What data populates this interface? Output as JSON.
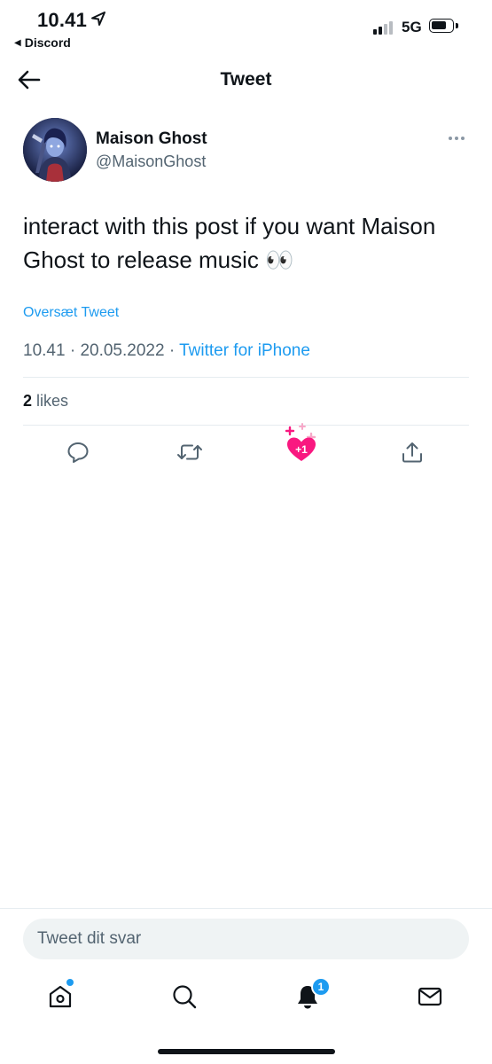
{
  "status_bar": {
    "time": "10.41",
    "back_app": "Discord",
    "network": "5G"
  },
  "header": {
    "title": "Tweet"
  },
  "tweet": {
    "author_name": "Maison Ghost",
    "author_handle": "@MaisonGhost",
    "text": "interact with this post if you want Maison Ghost to release music 👀",
    "translate_label": "Oversæt Tweet",
    "time": "10.41",
    "date": "20.05.2022",
    "client": "Twitter for iPhone",
    "likes_count": "2",
    "likes_label": "likes",
    "like_badge": "+1"
  },
  "reply": {
    "placeholder": "Tweet dit svar"
  },
  "tab_bar": {
    "notifications_badge": "1"
  },
  "colors": {
    "accent": "#1d9bf0",
    "like": "#f91880",
    "text": "#0f1419",
    "muted": "#536471"
  },
  "icons": [
    "location-arrow-icon",
    "back-arrow-icon",
    "more-icon",
    "reply-icon",
    "retweet-icon",
    "like-heart-icon",
    "share-icon",
    "home-icon",
    "search-icon",
    "bell-icon",
    "mail-icon"
  ]
}
